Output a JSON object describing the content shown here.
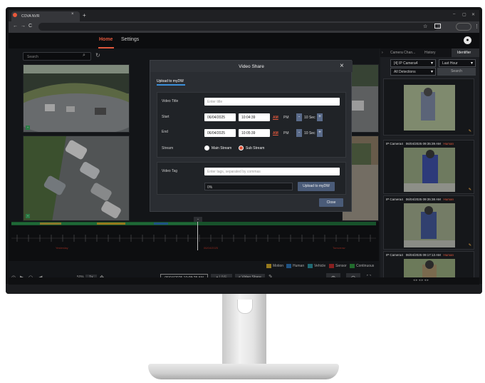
{
  "browser": {
    "tab_title": "COVA NVR",
    "tab_close": "×",
    "new_tab": "+",
    "win_min": "–",
    "win_max": "▢",
    "win_close": "✕",
    "back": "←",
    "forward": "→",
    "reload": "C",
    "star": "☆",
    "menu": "⋮"
  },
  "header": {
    "nav": [
      {
        "label": "Home",
        "active": true
      },
      {
        "label": "Settings",
        "active": false
      }
    ]
  },
  "search": {
    "placeholder": "Search"
  },
  "timeline": {
    "labels": [
      "Yesterday",
      "06/04/2025",
      "Tomorrow"
    ]
  },
  "legend": [
    {
      "label": "Motion",
      "color": "#c9a227"
    },
    {
      "label": "Human",
      "color": "#2a6fb0"
    },
    {
      "label": "Vehicle",
      "color": "#2a8c9a"
    },
    {
      "label": "Sensor",
      "color": "#b52a2a"
    },
    {
      "label": "Continuous",
      "color": "#2c8f3c"
    }
  ],
  "controls": {
    "volume": "50%",
    "speed": "1x",
    "datetime": "06/04/2025 10:08:28 AM",
    "live": "● LIVE",
    "video_share": "< Video Share"
  },
  "right_panel": {
    "tabs": [
      "Camera Chan...",
      "History",
      "Identifier"
    ],
    "camera_select": "[4] IP Camera4",
    "time_select": "Last Hour",
    "detection_select": "All Detections",
    "search_button": "Search",
    "cards": [
      {
        "camera": "",
        "time": "",
        "type": ""
      },
      {
        "camera": "IP Camera4",
        "time": "06/04/2025 09:35:39 AM",
        "type": "Human"
      },
      {
        "camera": "IP Camera4",
        "time": "06/04/2025 09:35:38 AM",
        "type": "Human"
      },
      {
        "camera": "IP Camera4",
        "time": "06/04/2025 09:17:13 AM",
        "type": "Human"
      }
    ]
  },
  "modal": {
    "title": "Video Share",
    "tab": "Upload to myDW",
    "video_title_label": "Video Title",
    "video_title_placeholder": "Enter title",
    "start_label": "Start",
    "start_date": "06/04/2025",
    "start_time": "10:04:39",
    "end_label": "End",
    "end_date": "06/04/2025",
    "end_time": "10:05:39",
    "am": "AM",
    "pm": "PM",
    "step_value": "10 Sec",
    "minus": "-",
    "plus": "+",
    "stream_label": "Stream",
    "main_stream": "Main Stream",
    "sub_stream": "Sub Stream",
    "selected_stream": "Sub Stream",
    "video_tag_label": "Video Tag",
    "video_tag_placeholder": "Enter tags, separated by commas",
    "progress": "0%",
    "upload_button": "Upload to myDW",
    "close_button": "Close"
  }
}
